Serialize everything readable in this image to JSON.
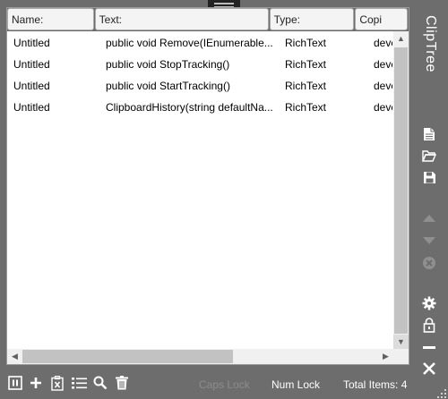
{
  "app": {
    "title": "ClipTree"
  },
  "table": {
    "columns": [
      "Name:",
      "Text:",
      "Type:",
      "Copi"
    ],
    "rows": [
      {
        "name": "Untitled",
        "text": "public void Remove(IEnumerable...",
        "type": "RichText",
        "copied": "deve"
      },
      {
        "name": "Untitled",
        "text": "public void StopTracking()",
        "type": "RichText",
        "copied": "deve"
      },
      {
        "name": "Untitled",
        "text": "public void StartTracking()",
        "type": "RichText",
        "copied": "deve"
      },
      {
        "name": "Untitled",
        "text": "ClipboardHistory(string defaultNa...",
        "type": "RichText",
        "copied": "deve"
      }
    ]
  },
  "sidebar_icons": [
    "new-document-icon",
    "open-folder-icon",
    "save-icon",
    "move-up-icon",
    "move-down-icon",
    "remove-icon",
    "settings-icon",
    "lock-icon",
    "minimize-icon",
    "close-icon"
  ],
  "toolbar_icons": [
    "pause-icon",
    "add-icon",
    "clear-icon",
    "list-view-icon",
    "search-icon",
    "delete-icon"
  ],
  "status": {
    "caps_lock": "Caps Lock",
    "num_lock": "Num Lock",
    "total_items": "Total Items: 4"
  },
  "colors": {
    "background": "#6d6d6d",
    "panel": "#ffffff",
    "icon": "#ffffff",
    "icon_disabled": "#8f8f8f",
    "status_dim": "#8c8c8c"
  }
}
